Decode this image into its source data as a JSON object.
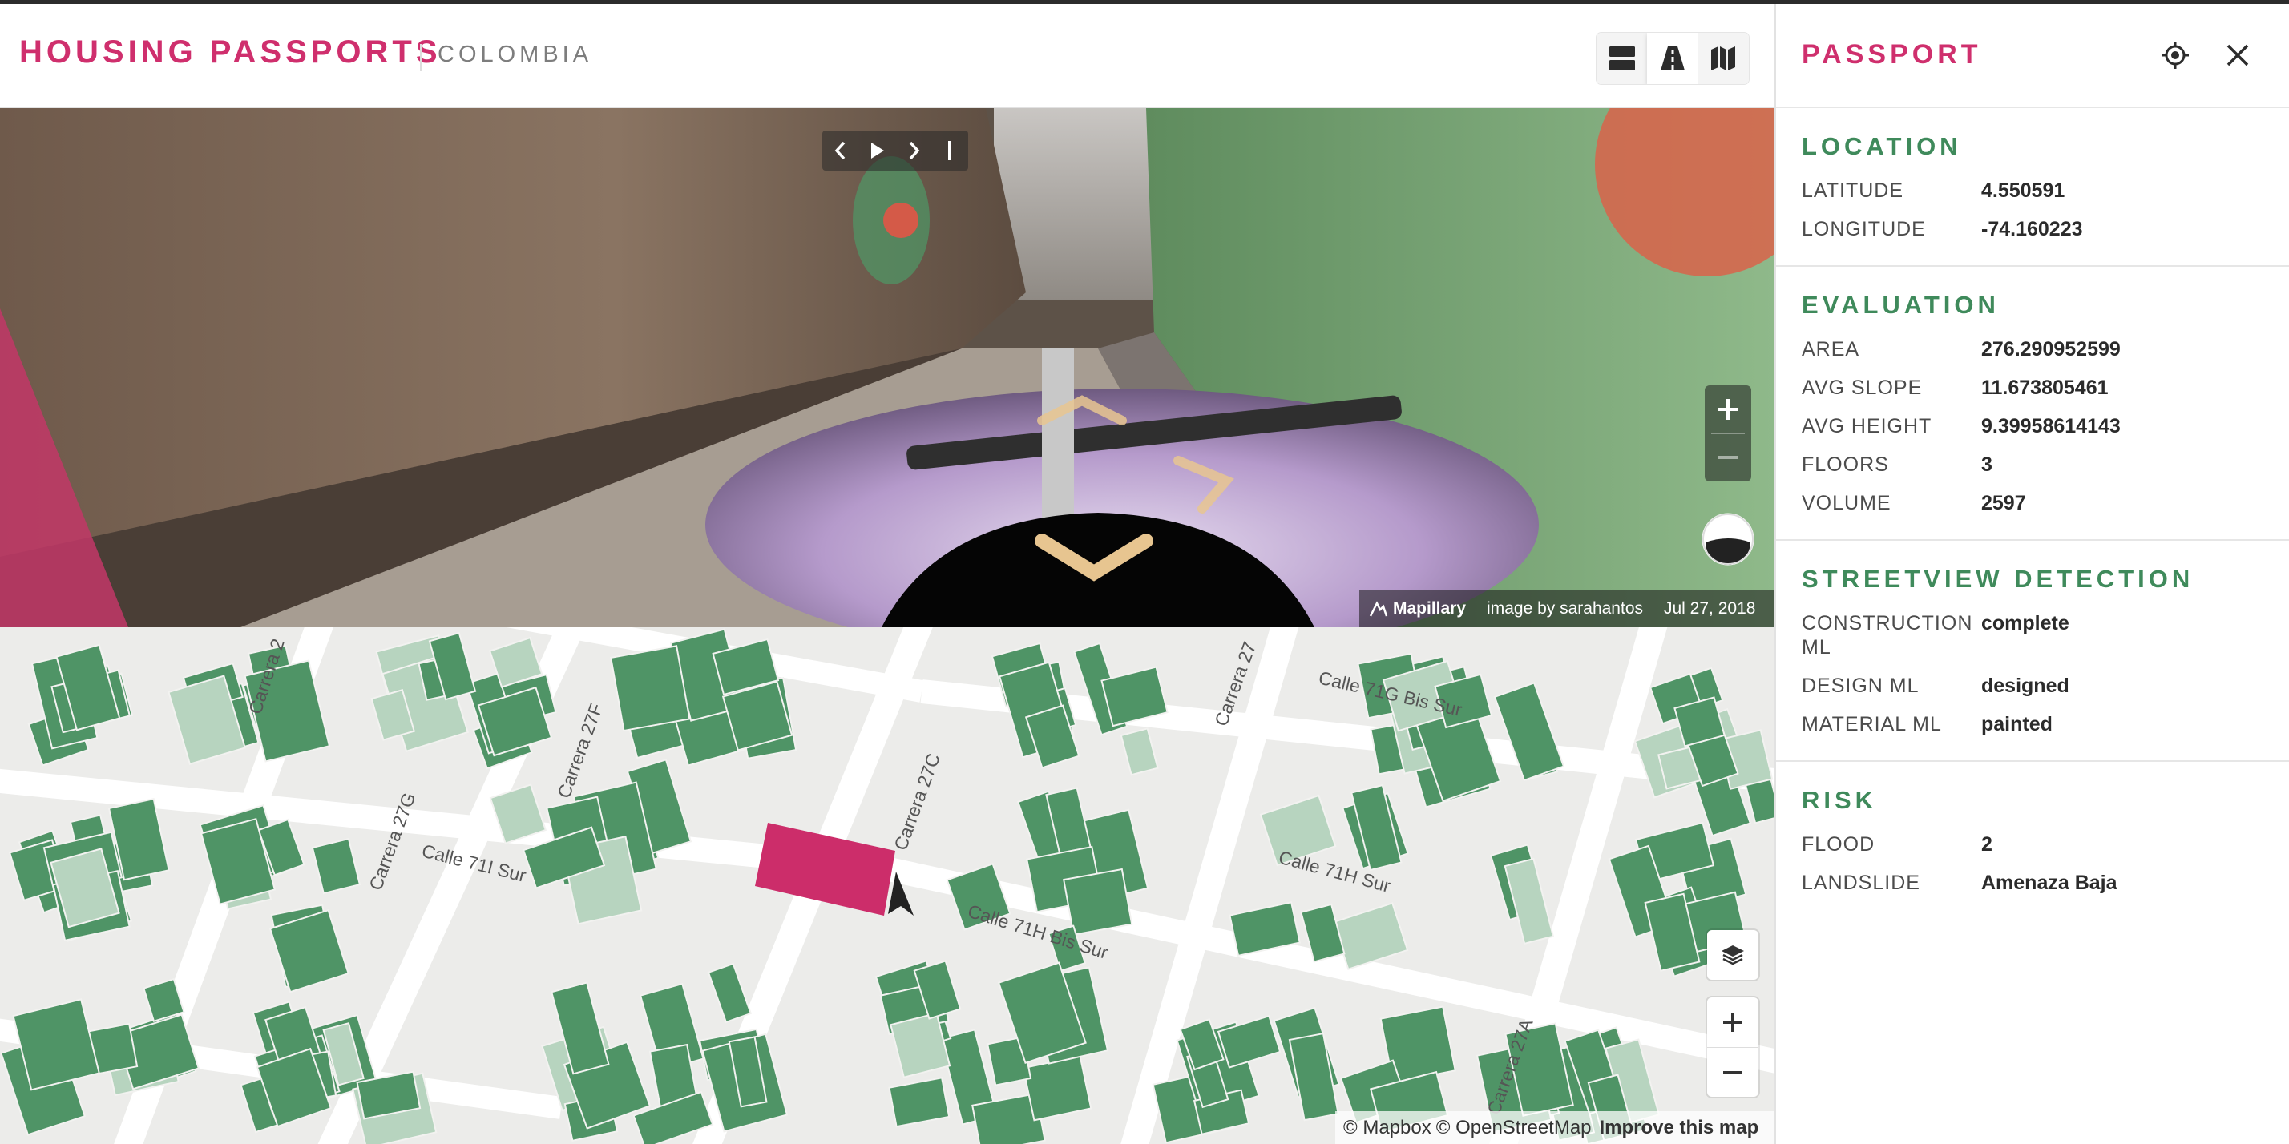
{
  "header": {
    "brand": "HOUSING PASSPORTS",
    "country": "COLOMBIA",
    "view_buttons": [
      {
        "icon": "split-view-icon"
      },
      {
        "icon": "road-view-icon"
      },
      {
        "icon": "map-view-icon"
      }
    ]
  },
  "streetview": {
    "controls": [
      {
        "icon": "chevron-left-icon"
      },
      {
        "icon": "play-icon"
      },
      {
        "icon": "chevron-right-icon"
      },
      {
        "icon": "stop-bar-icon"
      }
    ],
    "zoom_in": "+",
    "zoom_out": "−",
    "attribution": {
      "logo": "Mapillary",
      "credit": "image by sarahantos",
      "date": "Jul 27, 2018"
    }
  },
  "map": {
    "streets": [
      "Carrera 2",
      "Carrera 27F",
      "Carrera 27G",
      "Calle 71I Sur",
      "Carrera 27C",
      "Carrera 27",
      "Calle 71G Bis Sur",
      "Calle 71H Sur",
      "Calle 71H Bis Sur",
      "Carrera 27A"
    ],
    "zoom_in": "+",
    "zoom_out": "−",
    "attribution": {
      "mapbox": "© Mapbox",
      "osm": "© OpenStreetMap",
      "improve": "Improve this map"
    }
  },
  "panel": {
    "title": "PASSPORT",
    "sections": {
      "location": {
        "title": "LOCATION",
        "rows": [
          {
            "label": "LATITUDE",
            "value": "4.550591"
          },
          {
            "label": "LONGITUDE",
            "value": "-74.160223"
          }
        ]
      },
      "evaluation": {
        "title": "EVALUATION",
        "rows": [
          {
            "label": "AREA",
            "value": "276.290952599"
          },
          {
            "label": "AVG SLOPE",
            "value": "11.673805461"
          },
          {
            "label": "AVG HEIGHT",
            "value": "9.39958614143"
          },
          {
            "label": "FLOORS",
            "value": "3"
          },
          {
            "label": "VOLUME",
            "value": "2597"
          }
        ]
      },
      "streetview_detection": {
        "title": "STREETVIEW DETECTION",
        "rows": [
          {
            "label": "CONSTRUCTION ML",
            "value": "complete"
          },
          {
            "label": "DESIGN ML",
            "value": "designed"
          },
          {
            "label": "MATERIAL ML",
            "value": "painted"
          }
        ]
      },
      "risk": {
        "title": "RISK",
        "rows": [
          {
            "label": "FLOOD",
            "value": "2"
          },
          {
            "label": "LANDSLIDE",
            "value": "Amenaza Baja"
          }
        ]
      }
    }
  },
  "colors": {
    "brand": "#cf2f6d",
    "section_title": "#3f8a5b",
    "building": "#4f9466",
    "building_light": "#b7d4bf",
    "selected_building": "#cc2d6a"
  }
}
